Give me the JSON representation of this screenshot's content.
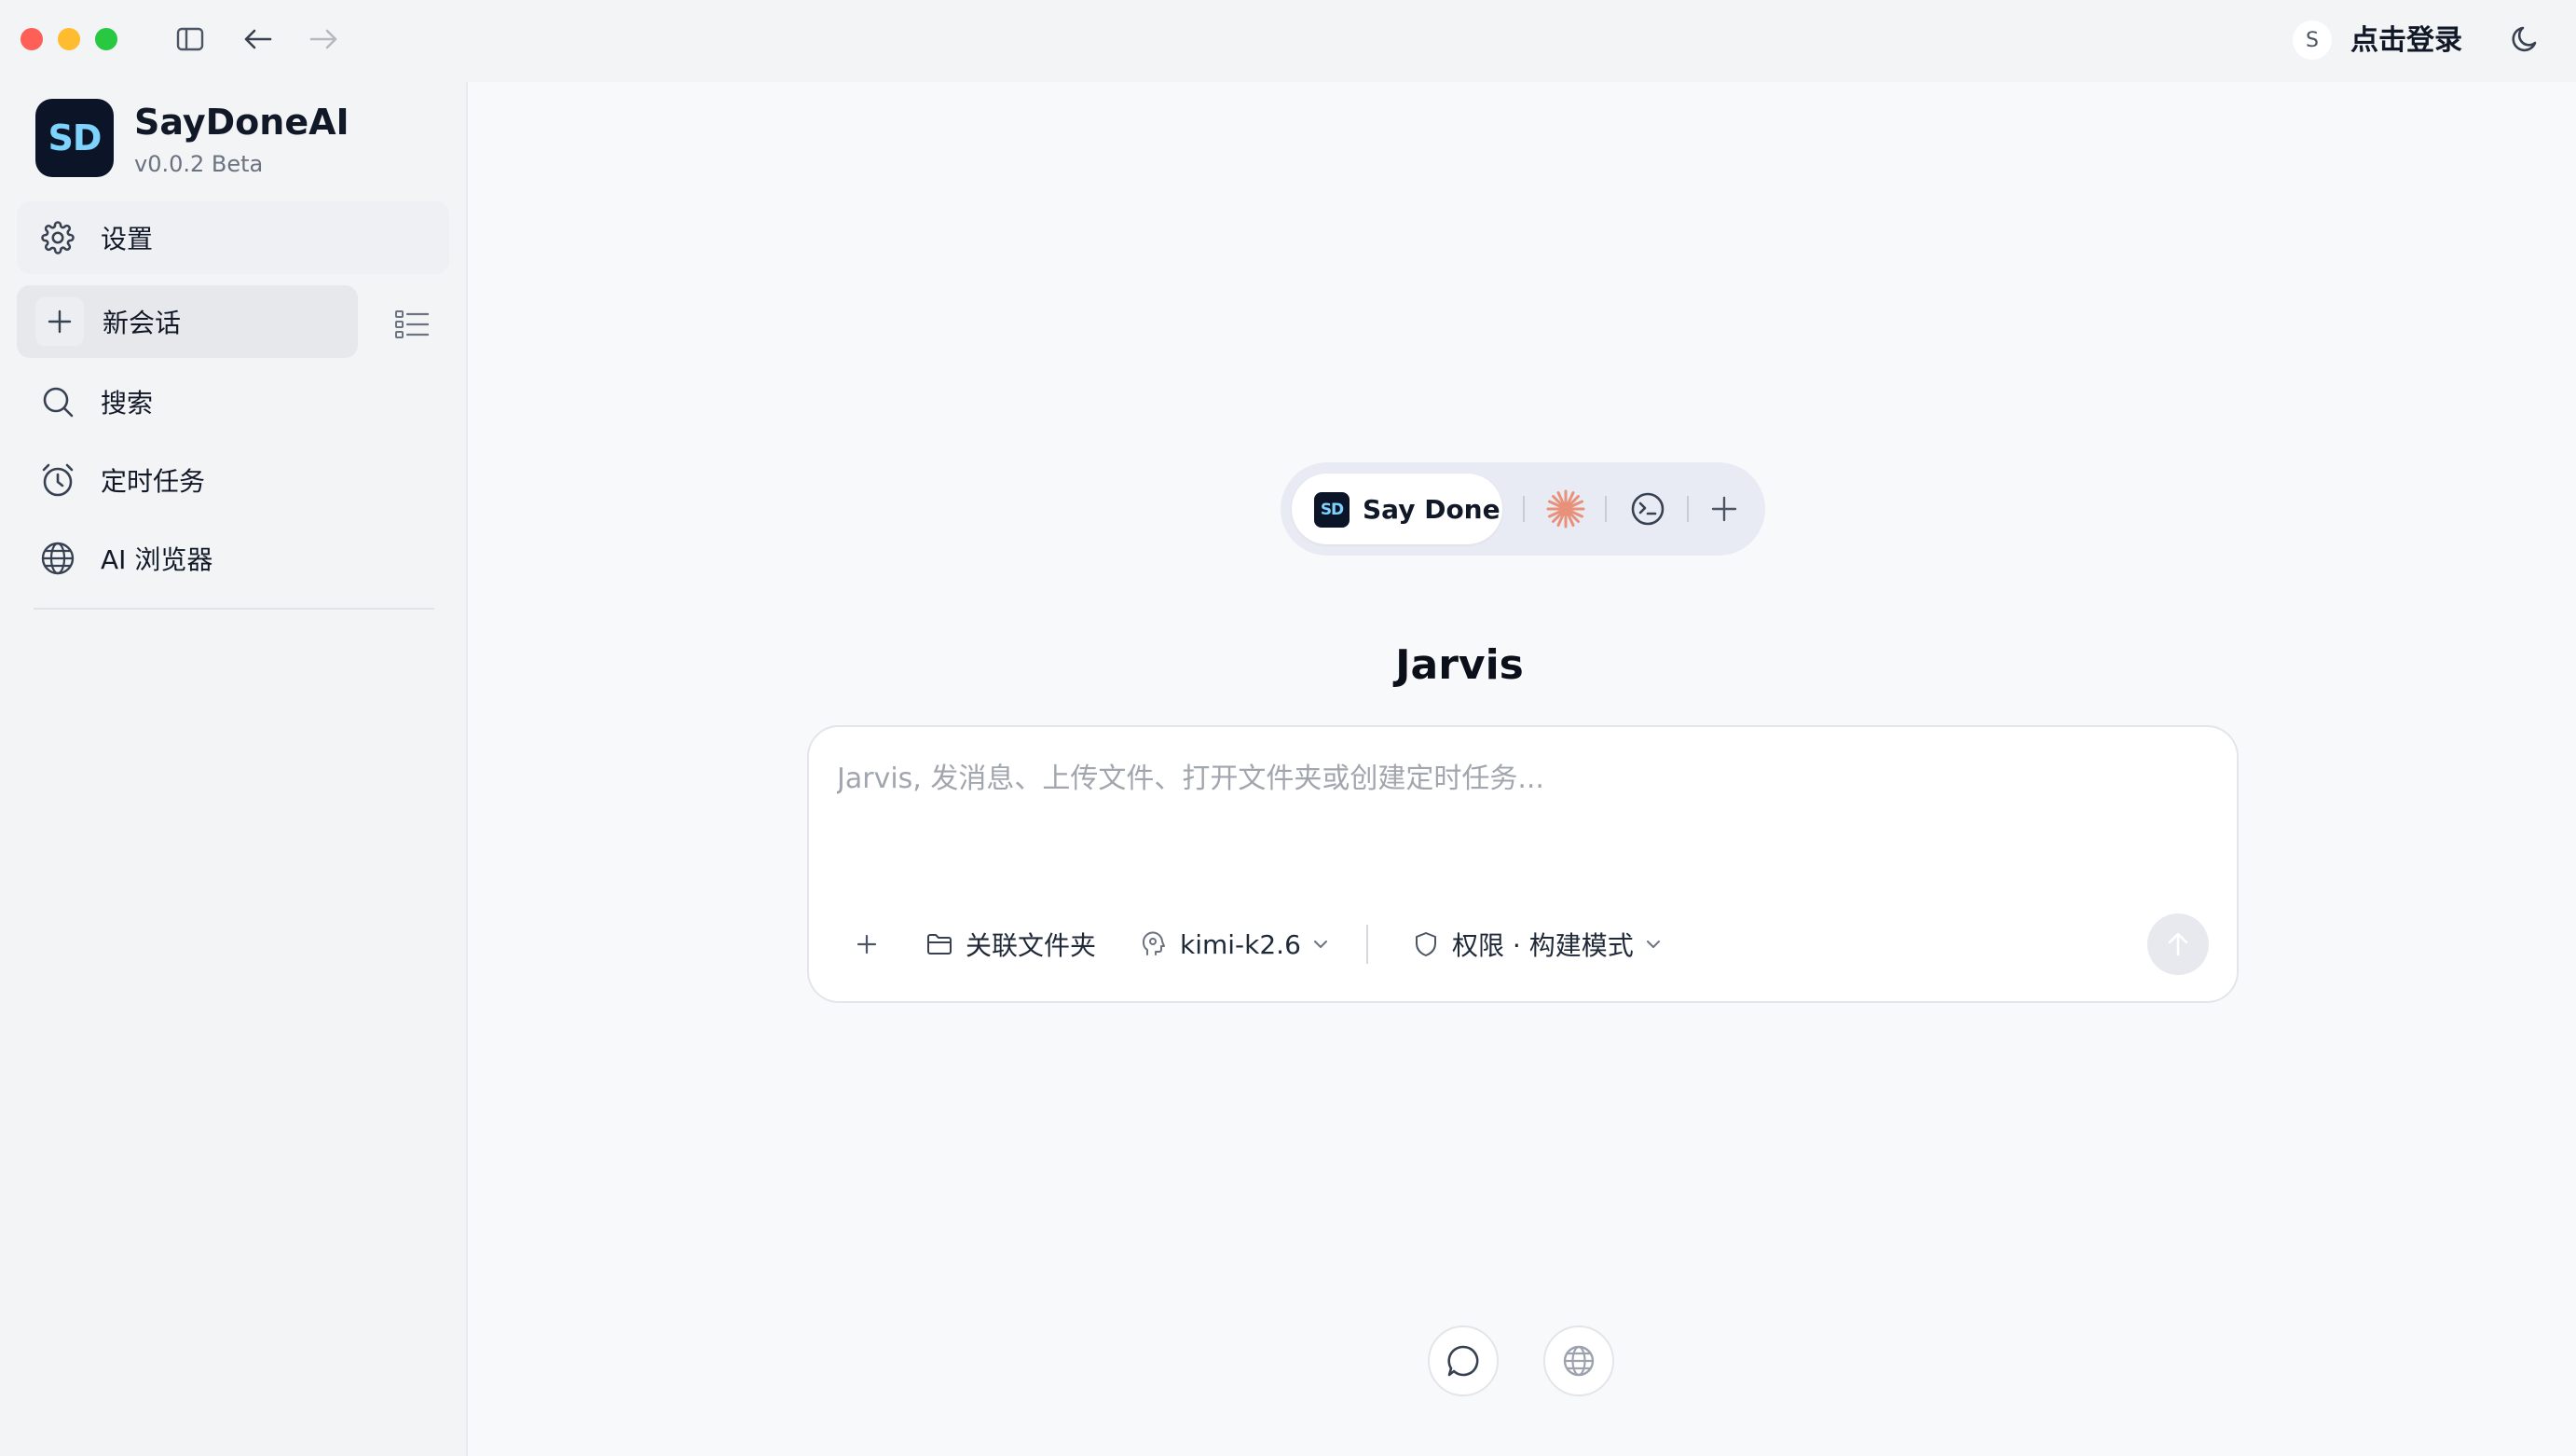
{
  "window": {
    "login_avatar": "S",
    "login_label": "点击登录"
  },
  "app": {
    "logo_text": "SD",
    "name": "SayDoneAI",
    "version": "v0.0.2 Beta"
  },
  "sidebar": {
    "items": [
      {
        "id": "settings",
        "label": "设置",
        "icon": "gear-icon"
      },
      {
        "id": "new-chat",
        "label": "新会话",
        "icon": "plus-icon"
      },
      {
        "id": "search",
        "label": "搜索",
        "icon": "search-icon"
      },
      {
        "id": "scheduled",
        "label": "定时任务",
        "icon": "alarm-clock-icon"
      },
      {
        "id": "ai-browser",
        "label": "AI 浏览器",
        "icon": "globe-icon"
      }
    ]
  },
  "agents": {
    "active_logo": "SD",
    "active_name": "Say Done",
    "others": [
      "sparkle-icon",
      "terminal-icon",
      "plus-icon"
    ]
  },
  "composer": {
    "title": "Jarvis",
    "placeholder": "Jarvis, 发消息、上传文件、打开文件夹或创建定时任务...",
    "value": "",
    "folder_label": "关联文件夹",
    "model_label": "kimi-k2.6",
    "permission_label": "权限 · 构建模式"
  },
  "colors": {
    "accent_logo_bg": "#0c1528",
    "accent_logo_text": "#7dd3fc",
    "sparkle": "#e8917a"
  }
}
